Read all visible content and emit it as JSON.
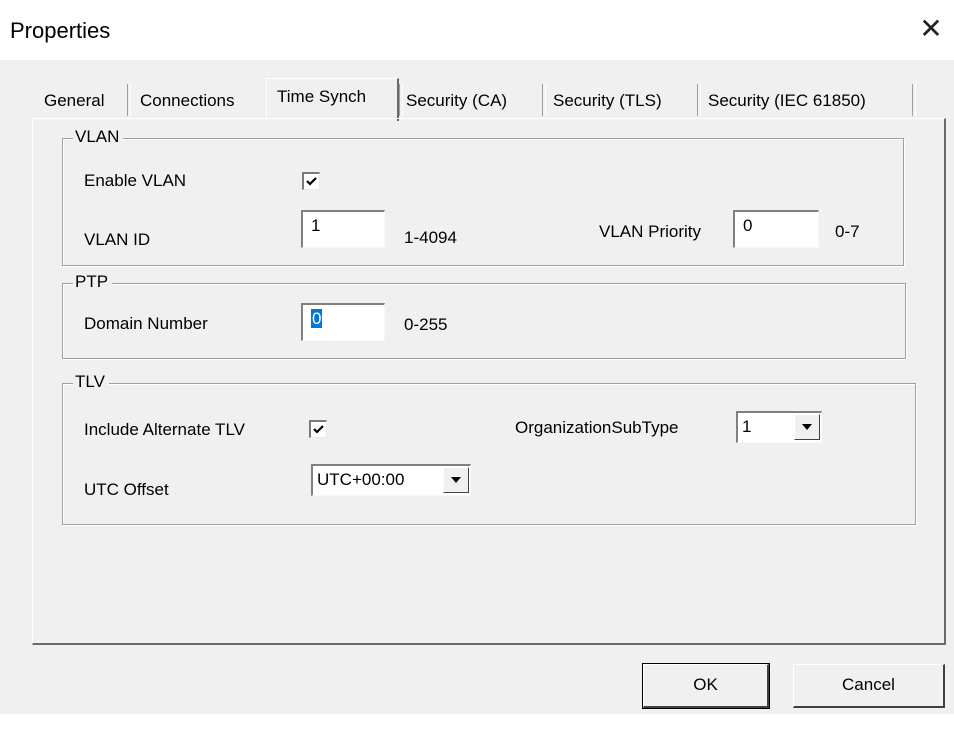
{
  "window": {
    "title": "Properties",
    "close_glyph": "✕"
  },
  "tabs": [
    {
      "label": "General"
    },
    {
      "label": "Connections"
    },
    {
      "label": "Time Synch",
      "active": true
    },
    {
      "label": "Security (CA)"
    },
    {
      "label": "Security (TLS)"
    },
    {
      "label": "Security (IEC 61850)"
    }
  ],
  "vlan": {
    "legend": "VLAN",
    "enable_label": "Enable VLAN",
    "enable_checked": true,
    "id_label": "VLAN ID",
    "id_value": "1",
    "id_range": "1-4094",
    "priority_label": "VLAN Priority",
    "priority_value": "0",
    "priority_range": "0-7"
  },
  "ptp": {
    "legend": "PTP",
    "domain_label": "Domain Number",
    "domain_value": "0",
    "domain_range": "0-255"
  },
  "tlv": {
    "legend": "TLV",
    "alt_label": "Include Alternate TLV",
    "alt_checked": true,
    "org_label": "OrganizationSubType",
    "org_value": "1",
    "utc_label": "UTC Offset",
    "utc_value": "UTC+00:00"
  },
  "buttons": {
    "ok": "OK",
    "cancel": "Cancel"
  },
  "icons": {
    "close": "close-icon",
    "check": "checkmark-icon",
    "dropdown": "chevron-down-icon"
  }
}
